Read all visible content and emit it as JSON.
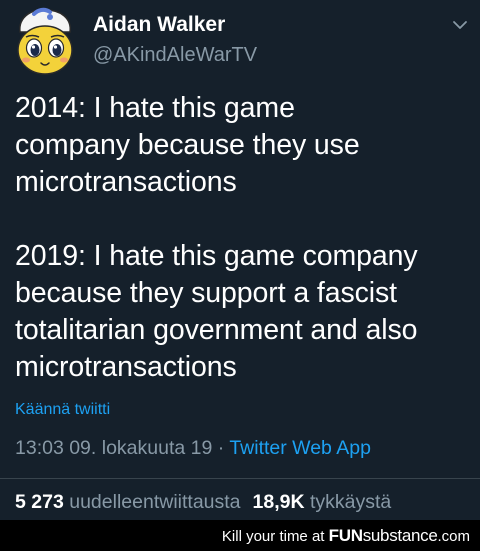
{
  "tweet": {
    "author_name": "Aidan Walker",
    "author_handle": "@AKindAleWarTV",
    "text": "2014: I hate this game\ncompany because they use\nmicrotransactions\n\n2019: I hate this game company\nbecause they support a fascist\ntotalitarian government and also\nmicrotransactions",
    "translate_link": "Käännä twiitti",
    "timestamp": "13:03 09. lokakuuta 19",
    "separator": " · ",
    "source_app": "Twitter Web App",
    "retweet_count": "5 273",
    "retweet_label": "uudelleentwiittausta",
    "like_count": "18,9K",
    "like_label": "tykkäystä"
  },
  "icons": {
    "avatar": "cartoon-face-avatar",
    "menu": "chevron-down-icon"
  },
  "watermark": {
    "prefix": "Kill your time at",
    "brand_fun": "FUN",
    "brand_sub": "substance",
    "suffix": ".com"
  },
  "colors": {
    "background": "#15202b",
    "primary_text": "#ffffff",
    "secondary_text": "#8899a6",
    "link": "#1da1f2",
    "divider": "#38444d"
  }
}
